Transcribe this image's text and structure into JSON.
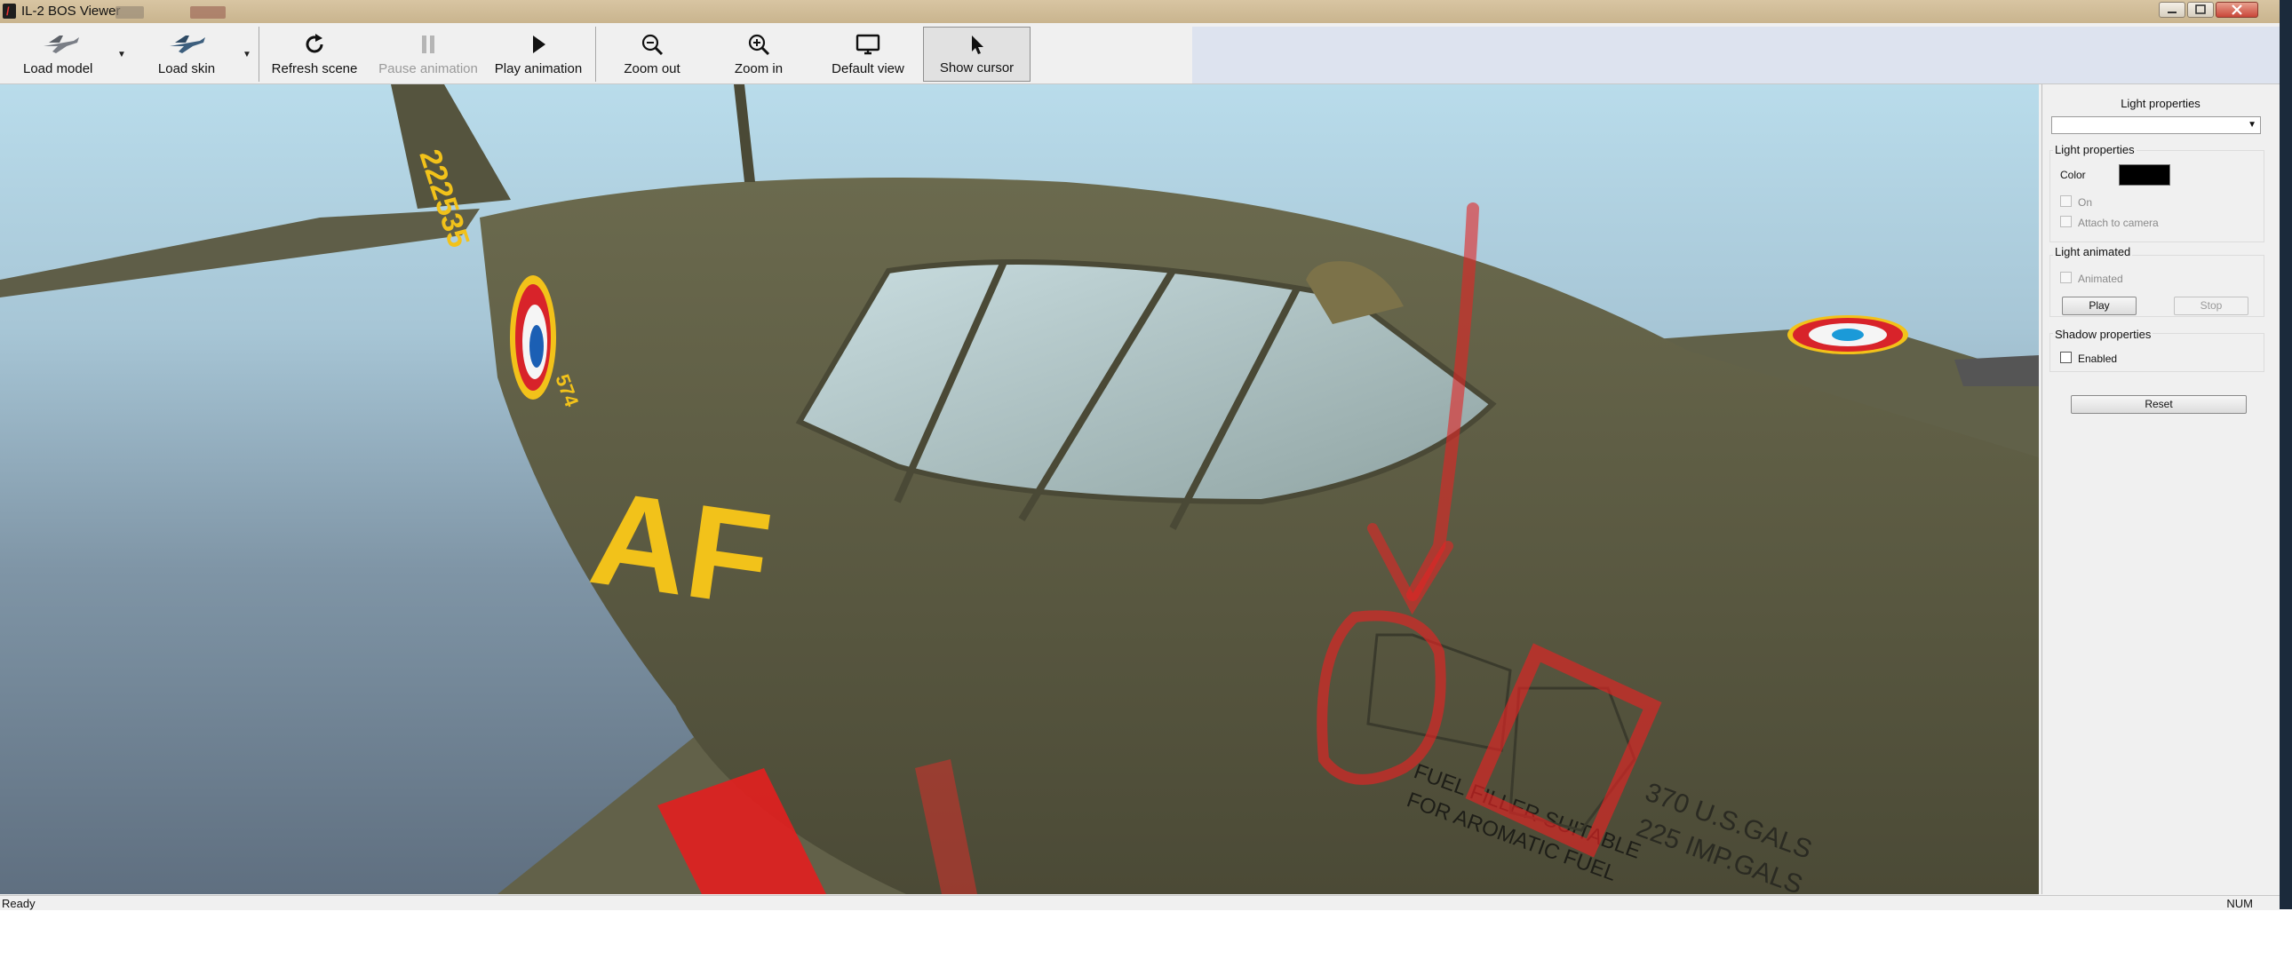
{
  "window": {
    "title": "IL-2 BOS Viewer",
    "app_icon": "il2-app-icon",
    "controls": [
      "minimize-icon",
      "maximize-icon",
      "close-icon"
    ]
  },
  "toolbar": {
    "load_model": "Load model",
    "load_skin": "Load skin",
    "refresh_scene": "Refresh scene",
    "pause_animation": "Pause animation",
    "play_animation": "Play animation",
    "zoom_out": "Zoom out",
    "zoom_in": "Zoom in",
    "default_view": "Default view",
    "show_cursor": "Show cursor"
  },
  "viewport": {
    "tail_code": "222535",
    "fuselage_letters": "AF",
    "small_number": "574",
    "fuel_text_1": "FUEL FILLER SUITABLE",
    "fuel_text_2": "FOR AROMATIC FUEL",
    "gals_text_1": "370 U.S.GALS",
    "gals_text_2": "225 IMP.GALS",
    "colors": {
      "olive_drab": "#5e5a3e",
      "roundel_red": "#d8232a",
      "roundel_blue": "#1b5fb4",
      "insignia_yellow": "#f2c21a",
      "annotation_red": "#e32424"
    }
  },
  "panel": {
    "title": "Light properties",
    "dropdown_value": "",
    "light_group": "Light properties",
    "color_label": "Color",
    "color_value": "#000000",
    "on_label": "On",
    "attach_label": "Attach to camera",
    "animated_group": "Light animated",
    "animated_label": "Animated",
    "play_label": "Play",
    "stop_label": "Stop",
    "shadow_group": "Shadow properties",
    "enabled_label": "Enabled",
    "reset_label": "Reset"
  },
  "status": {
    "left": "Ready",
    "right": "NUM"
  }
}
